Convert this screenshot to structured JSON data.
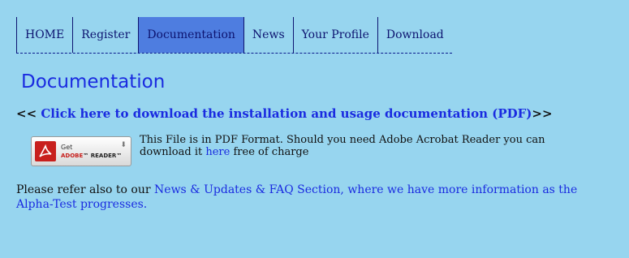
{
  "nav": {
    "items": [
      {
        "label": "HOME"
      },
      {
        "label": "Register"
      },
      {
        "label": "Documentation"
      },
      {
        "label": "News"
      },
      {
        "label": "Your Profile"
      },
      {
        "label": "Download"
      }
    ],
    "active": "Documentation"
  },
  "page": {
    "heading": "Documentation"
  },
  "download": {
    "prefix": "<< ",
    "link_text": "Click here to download the installation and usage documentation (PDF)",
    "suffix": ">>"
  },
  "reader_badge": {
    "get": "Get",
    "brand_adobe": "ADOBE",
    "brand_reader": "READER",
    "icon": "adobe-reader-icon"
  },
  "pdf_note": {
    "text_before": "This File is in PDF Format. Should you need Adobe Acrobat Reader you can download it ",
    "link": "here",
    "text_after": " free of charge"
  },
  "refer": {
    "text_before": "Please refer also to our ",
    "link": "News & Updates & FAQ Section, where we have more information as the",
    "line2": "Alpha-Test progresses."
  },
  "colors": {
    "background": "#97d5ef",
    "active_tab": "#4e7de0",
    "link": "#1a2be0"
  }
}
